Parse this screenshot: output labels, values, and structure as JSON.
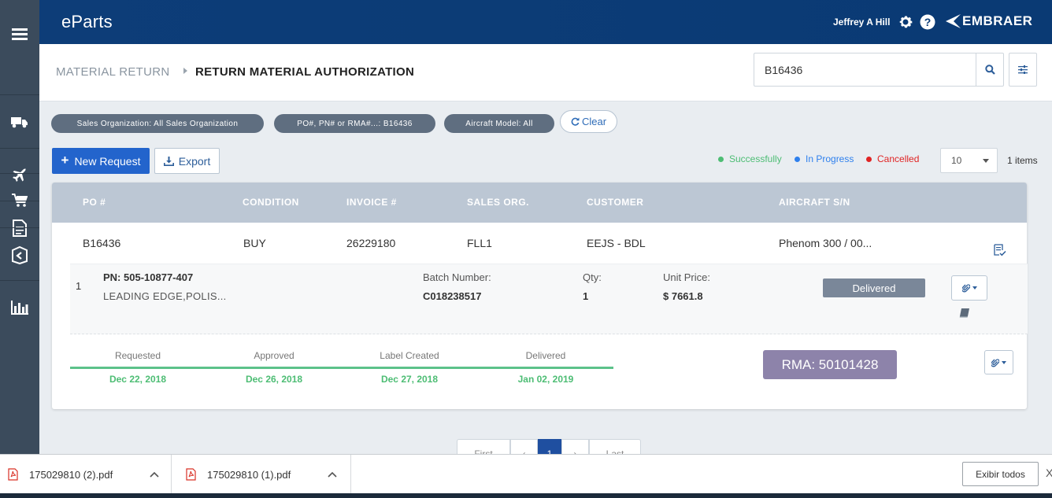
{
  "app": {
    "brand": "eParts",
    "user_name": "Jeffrey A Hill",
    "logo_text": "EMBRAER"
  },
  "sidebar": {
    "items": [
      {
        "icon": "truck-icon"
      },
      {
        "icon": "airplane-icon"
      },
      {
        "icon": "cart-icon"
      },
      {
        "icon": "document-icon"
      },
      {
        "icon": "return-box-icon"
      },
      {
        "icon": "bar-chart-icon"
      }
    ]
  },
  "breadcrumb": {
    "parent": "MATERIAL RETURN",
    "current": "RETURN MATERIAL AUTHORIZATION"
  },
  "search": {
    "value": "B16436",
    "placeholder": ""
  },
  "filters": {
    "chips": [
      "Sales Organization: All Sales Organization",
      "PO#, PN# or RMA#...: B16436",
      "Aircraft Model: All"
    ],
    "clear_label": "Clear"
  },
  "actions": {
    "new_request": "New Request",
    "export": "Export"
  },
  "legend": {
    "items": [
      {
        "label": "Successfully",
        "color": "#4dbd74"
      },
      {
        "label": "In Progress",
        "color": "#2f80ed"
      },
      {
        "label": "Cancelled",
        "color": "#e02424"
      }
    ]
  },
  "paging": {
    "page_size": "10",
    "items_count": "1 items"
  },
  "table": {
    "columns": [
      "PO #",
      "CONDITION",
      "INVOICE #",
      "SALES ORG.",
      "CUSTOMER",
      "AIRCRAFT S/N"
    ],
    "row": {
      "po": "B16436",
      "condition": "BUY",
      "invoice": "26229180",
      "sales_org": "FLL1",
      "customer": "EEJS - BDL",
      "aircraft": "Phenom 300 / 00..."
    },
    "line_item": {
      "index": "1",
      "pn": "PN: 505-10877-407",
      "description": "LEADING EDGE,POLIS...",
      "batch_label": "Batch Number:",
      "batch_value": "C018238517",
      "qty_label": "Qty:",
      "qty_value": "1",
      "price_label": "Unit Price:",
      "price_value": "$ 7661.8",
      "status": "Delivered"
    },
    "timeline": [
      {
        "label": "Requested",
        "date": "Dec 22, 2018"
      },
      {
        "label": "Approved",
        "date": "Dec 26, 2018"
      },
      {
        "label": "Label Created",
        "date": "Dec 27, 2018"
      },
      {
        "label": "Delivered",
        "date": "Jan 02, 2019"
      }
    ],
    "rma": "RMA: 50101428"
  },
  "pagination": {
    "first": "First",
    "prev": "‹",
    "current": "1",
    "next": "›",
    "last": "Last"
  },
  "downloads": {
    "files": [
      "175029810 (2).pdf",
      "175029810 (1).pdf"
    ],
    "show_all": "Exibir todos",
    "close": "X"
  },
  "colors": {
    "header": "#0d3d78",
    "primary": "#2364cc",
    "sidebar": "#3b4b5c",
    "success": "#4dbd74",
    "rma": "#8d83aa"
  }
}
